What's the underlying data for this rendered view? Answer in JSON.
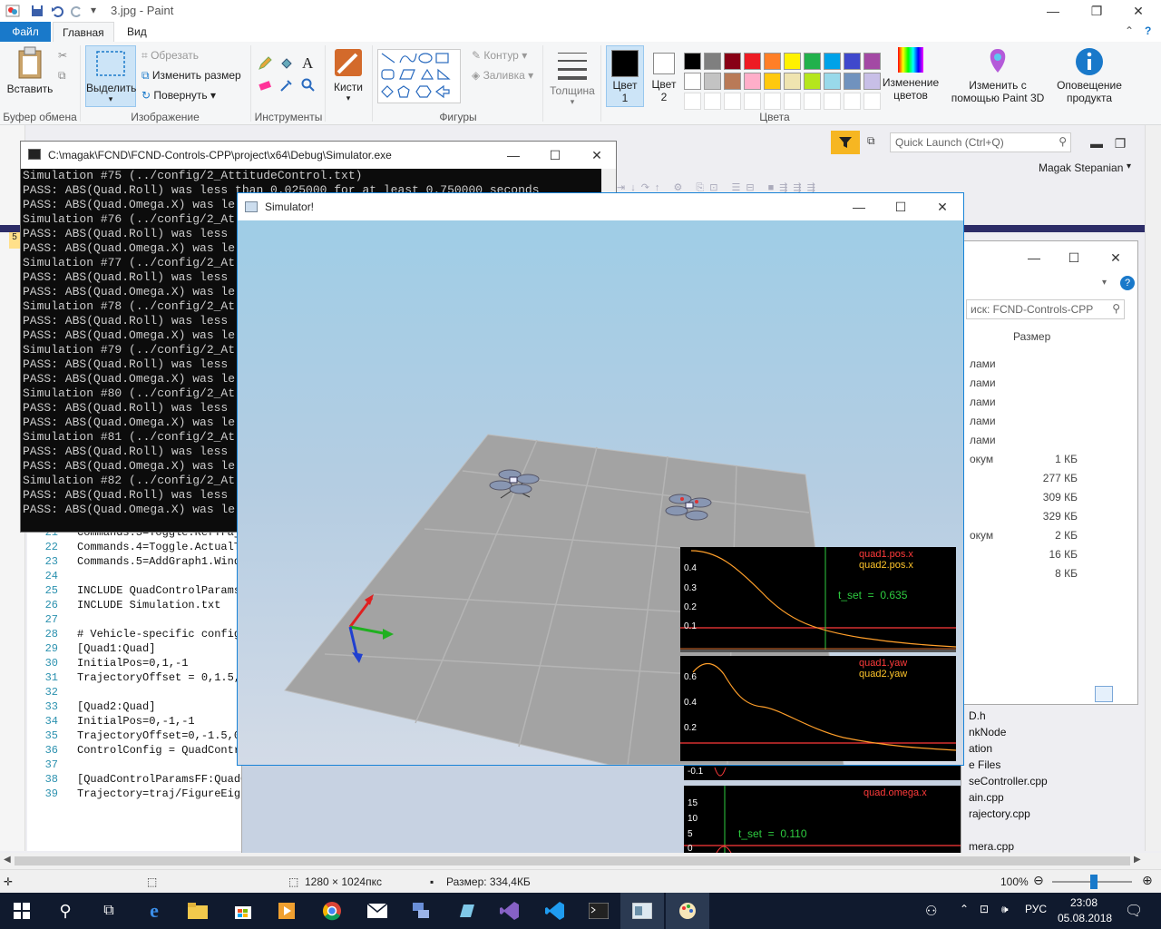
{
  "paint": {
    "title": "3.jpg - Paint",
    "menu": {
      "file": "Файл",
      "home": "Главная",
      "view": "Вид"
    },
    "ribbon": {
      "clipboard": {
        "paste": "Вставить",
        "label": "Буфер обмена"
      },
      "image": {
        "select": "Выделить",
        "crop": "Обрезать",
        "resize": "Изменить размер",
        "rotate": "Повернуть",
        "label": "Изображение"
      },
      "tools": {
        "label": "Инструменты"
      },
      "brushes": {
        "label": "Кисти"
      },
      "shapes": {
        "outline": "Контур",
        "fill": "Заливка",
        "label": "Фигуры"
      },
      "size": {
        "label": "Толщина"
      },
      "colors": {
        "color1": "Цвет 1",
        "color2": "Цвет 2",
        "edit": "Изменение цветов",
        "paint3d": "Изменить с помощью Paint 3D",
        "notify": "Оповещение продукта",
        "label": "Цвета",
        "palette_row1": [
          "#000000",
          "#7f7f7f",
          "#880015",
          "#ed1c24",
          "#ff7f27",
          "#fff200",
          "#22b14c",
          "#00a2e8",
          "#3f48cc",
          "#a349a4"
        ],
        "palette_row2": [
          "#ffffff",
          "#c3c3c3",
          "#b97a57",
          "#ffaec9",
          "#ffc90e",
          "#efe4b0",
          "#b5e61d",
          "#99d9ea",
          "#7092be",
          "#c8bfe7"
        ]
      }
    },
    "status": {
      "dimensions": "1280 × 1024пкс",
      "size": "Размер: 334,4КБ",
      "zoom": "100%"
    }
  },
  "vs": {
    "quick_launch": "Quick Launch (Ctrl+Q)",
    "user": "Magak Stepanian",
    "code_lines": [
      {
        "n": "21",
        "t": "Commands.3=Toggle.RefTraj"
      },
      {
        "n": "22",
        "t": "Commands.4=Toggle.ActualT"
      },
      {
        "n": "23",
        "t": "Commands.5=AddGraph1.Windo"
      },
      {
        "n": "24",
        "t": ""
      },
      {
        "n": "25",
        "t": "INCLUDE QuadControlParams"
      },
      {
        "n": "26",
        "t": "INCLUDE Simulation.txt"
      },
      {
        "n": "27",
        "t": ""
      },
      {
        "n": "28",
        "t": "# Vehicle-specific config"
      },
      {
        "n": "29",
        "t": "[Quad1:Quad]"
      },
      {
        "n": "30",
        "t": "InitialPos=0,1,-1"
      },
      {
        "n": "31",
        "t": "TrajectoryOffset = 0,1.5,"
      },
      {
        "n": "32",
        "t": ""
      },
      {
        "n": "33",
        "t": "[Quad2:Quad]"
      },
      {
        "n": "34",
        "t": "InitialPos=0,-1,-1"
      },
      {
        "n": "35",
        "t": "TrajectoryOffset=0,-1.5,0"
      },
      {
        "n": "36",
        "t": "ControlConfig = QuadContr"
      },
      {
        "n": "37",
        "t": ""
      },
      {
        "n": "38",
        "t": "[QuadControlParamsFF:QuadC"
      },
      {
        "n": "39",
        "t": "Trajectory=traj/FigureEigh"
      }
    ],
    "solution_items": [
      "D.h",
      "nkNode",
      "ation",
      "e Files",
      "seController.cpp",
      "ain.cpp",
      "rajectory.cpp",
      "mera.cpp"
    ]
  },
  "explorer": {
    "search": "иск: FCND-Controls-CPP",
    "size_header": "Размер",
    "rows": [
      {
        "name": "лами",
        "size": ""
      },
      {
        "name": "лами",
        "size": ""
      },
      {
        "name": "лами",
        "size": ""
      },
      {
        "name": "лами",
        "size": ""
      },
      {
        "name": "лами",
        "size": ""
      },
      {
        "name": "окум",
        "size": "1 КБ"
      },
      {
        "name": "",
        "size": "277 КБ"
      },
      {
        "name": "",
        "size": "309 КБ"
      },
      {
        "name": "",
        "size": "329 КБ"
      },
      {
        "name": "окум",
        "size": "2 КБ"
      },
      {
        "name": "",
        "size": "16 КБ"
      },
      {
        "name": "",
        "size": "8 КБ"
      }
    ]
  },
  "console": {
    "title": "C:\\magak\\FCND\\FCND-Controls-CPP\\project\\x64\\Debug\\Simulator.exe",
    "lines": [
      "Simulation #75 (../config/2_AttitudeControl.txt)",
      "PASS: ABS(Quad.Roll) was less than 0.025000 for at least 0.750000 seconds",
      "PASS: ABS(Quad.Omega.X) was le",
      "Simulation #76 (../config/2_At",
      "PASS: ABS(Quad.Roll) was less",
      "PASS: ABS(Quad.Omega.X) was le",
      "Simulation #77 (../config/2_At",
      "PASS: ABS(Quad.Roll) was less",
      "PASS: ABS(Quad.Omega.X) was le",
      "Simulation #78 (../config/2_At",
      "PASS: ABS(Quad.Roll) was less",
      "PASS: ABS(Quad.Omega.X) was le",
      "Simulation #79 (../config/2_At",
      "PASS: ABS(Quad.Roll) was less",
      "PASS: ABS(Quad.Omega.X) was le",
      "Simulation #80 (../config/2_At",
      "PASS: ABS(Quad.Roll) was less",
      "PASS: ABS(Quad.Omega.X) was le",
      "Simulation #81 (../config/2_At",
      "PASS: ABS(Quad.Roll) was less",
      "PASS: ABS(Quad.Omega.X) was le",
      "Simulation #82 (../config/2_At",
      "PASS: ABS(Quad.Roll) was less",
      "PASS: ABS(Quad.Omega.X) was le"
    ]
  },
  "simulator": {
    "title": "Simulator!",
    "graph1": {
      "legend": [
        "quad1.pos.x",
        "quad2.pos.x"
      ],
      "ticks": [
        "0.4",
        "0.3",
        "0.2",
        "0.1"
      ],
      "annotation": "t_set  =  0.635"
    },
    "graph2": {
      "legend": [
        "quad1.yaw",
        "quad2.yaw"
      ],
      "ticks": [
        "0.6",
        "0.4",
        "0.2"
      ]
    },
    "graph2_tail_tick": "-0.1",
    "graph3": {
      "legend": [
        "quad.omega.x"
      ],
      "ticks": [
        "15",
        "10",
        "5",
        "0"
      ],
      "annotation": "t_set  =  0.110"
    }
  },
  "taskbar": {
    "lang": "РУС",
    "time": "23:08",
    "date": "05.08.2018"
  }
}
